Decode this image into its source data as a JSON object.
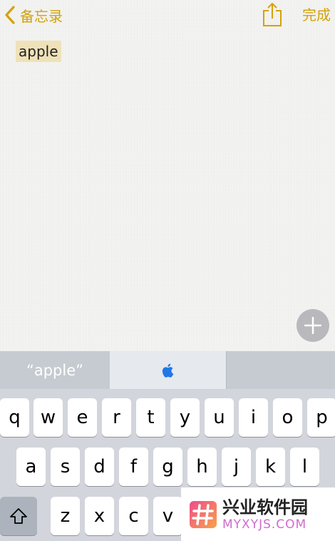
{
  "nav": {
    "back_label": "备忘录",
    "done_label": "完成",
    "accent_color": "#d4a20a"
  },
  "note": {
    "selected_text": "apple"
  },
  "icons": {
    "back": "chevron-left-icon",
    "share": "share-icon",
    "add": "plus-icon",
    "suggestion_emoji": "apple-logo-icon",
    "shift": "shift-arrow-icon"
  },
  "suggestions": {
    "first": "“apple”",
    "third": ""
  },
  "keyboard": {
    "row1": [
      "q",
      "w",
      "e",
      "r",
      "t",
      "y",
      "u",
      "i",
      "o",
      "p"
    ],
    "row2": [
      "a",
      "s",
      "d",
      "f",
      "g",
      "h",
      "j",
      "k",
      "l"
    ],
    "row3": [
      "z",
      "x",
      "c",
      "v"
    ]
  },
  "watermark": {
    "title": "兴业软件园",
    "subtitle": "MYXYJS.COM"
  }
}
